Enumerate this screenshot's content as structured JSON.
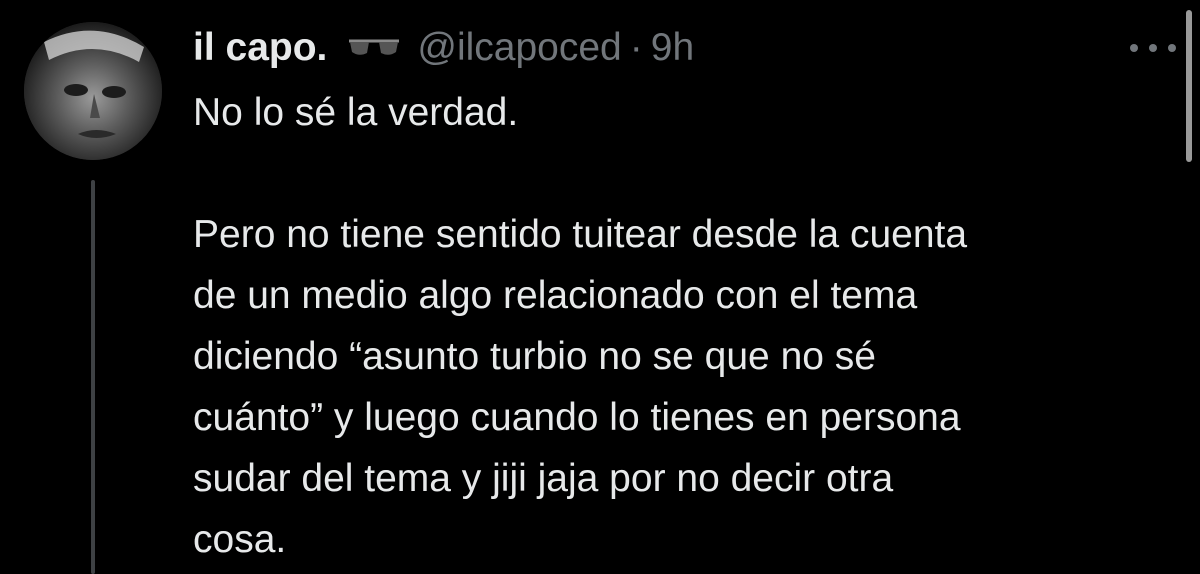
{
  "tweet": {
    "display_name": "il capo.",
    "emoji_icon": "sunglasses-icon",
    "handle": "@ilcapoced",
    "separator": "·",
    "time": "9h",
    "more_icon": "more-horizontal-icon",
    "text": "No lo sé la verdad.\n\nPero no tiene sentido tuitear desde la cuenta\nde un medio algo relacionado con el tema\ndiciendo “asunto turbio no se que no sé\ncuánto” y luego cuando lo tienes en persona\nsudar del tema y jiji jaja por no decir otra\ncosa."
  },
  "colors": {
    "background": "#000000",
    "primary_text": "#e7e9ea",
    "secondary_text": "#71767b",
    "thread_line": "#3e4144"
  }
}
